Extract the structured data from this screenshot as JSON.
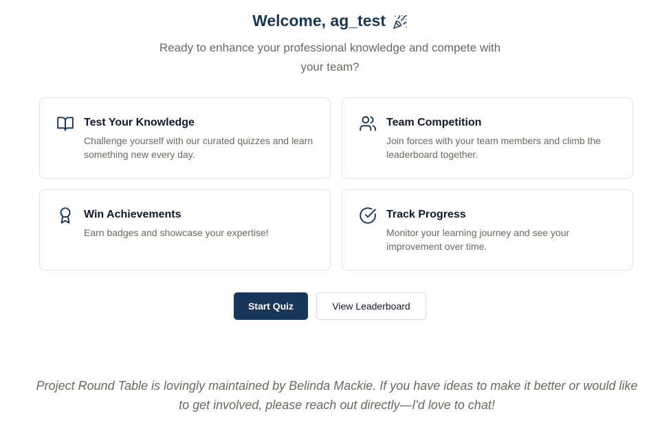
{
  "header": {
    "title": "Welcome, ag_test",
    "title_icon": "party-popper-icon",
    "subtitle": "Ready to enhance your professional knowledge and compete with your team?"
  },
  "cards": [
    {
      "icon": "open-book-icon",
      "title": "Test Your Knowledge",
      "description": "Challenge yourself with our curated quizzes and learn something new every day."
    },
    {
      "icon": "users-icon",
      "title": "Team Competition",
      "description": "Join forces with your team members and climb the leaderboard together."
    },
    {
      "icon": "award-ribbon-icon",
      "title": "Win Achievements",
      "description": "Earn badges and showcase your expertise!"
    },
    {
      "icon": "check-circle-icon",
      "title": "Track Progress",
      "description": "Monitor your learning journey and see your improvement over time."
    }
  ],
  "actions": {
    "start_quiz_label": "Start Quiz",
    "view_leaderboard_label": "View Leaderboard"
  },
  "footer": {
    "text": "Project Round Table is lovingly maintained by Belinda Mackie. If you have ideas to make it better or would like to get involved, please reach out directly—I'd love to chat!"
  },
  "colors": {
    "primary": "#17365a",
    "muted_text": "#6b6762",
    "card_border": "#e3e1dd"
  }
}
